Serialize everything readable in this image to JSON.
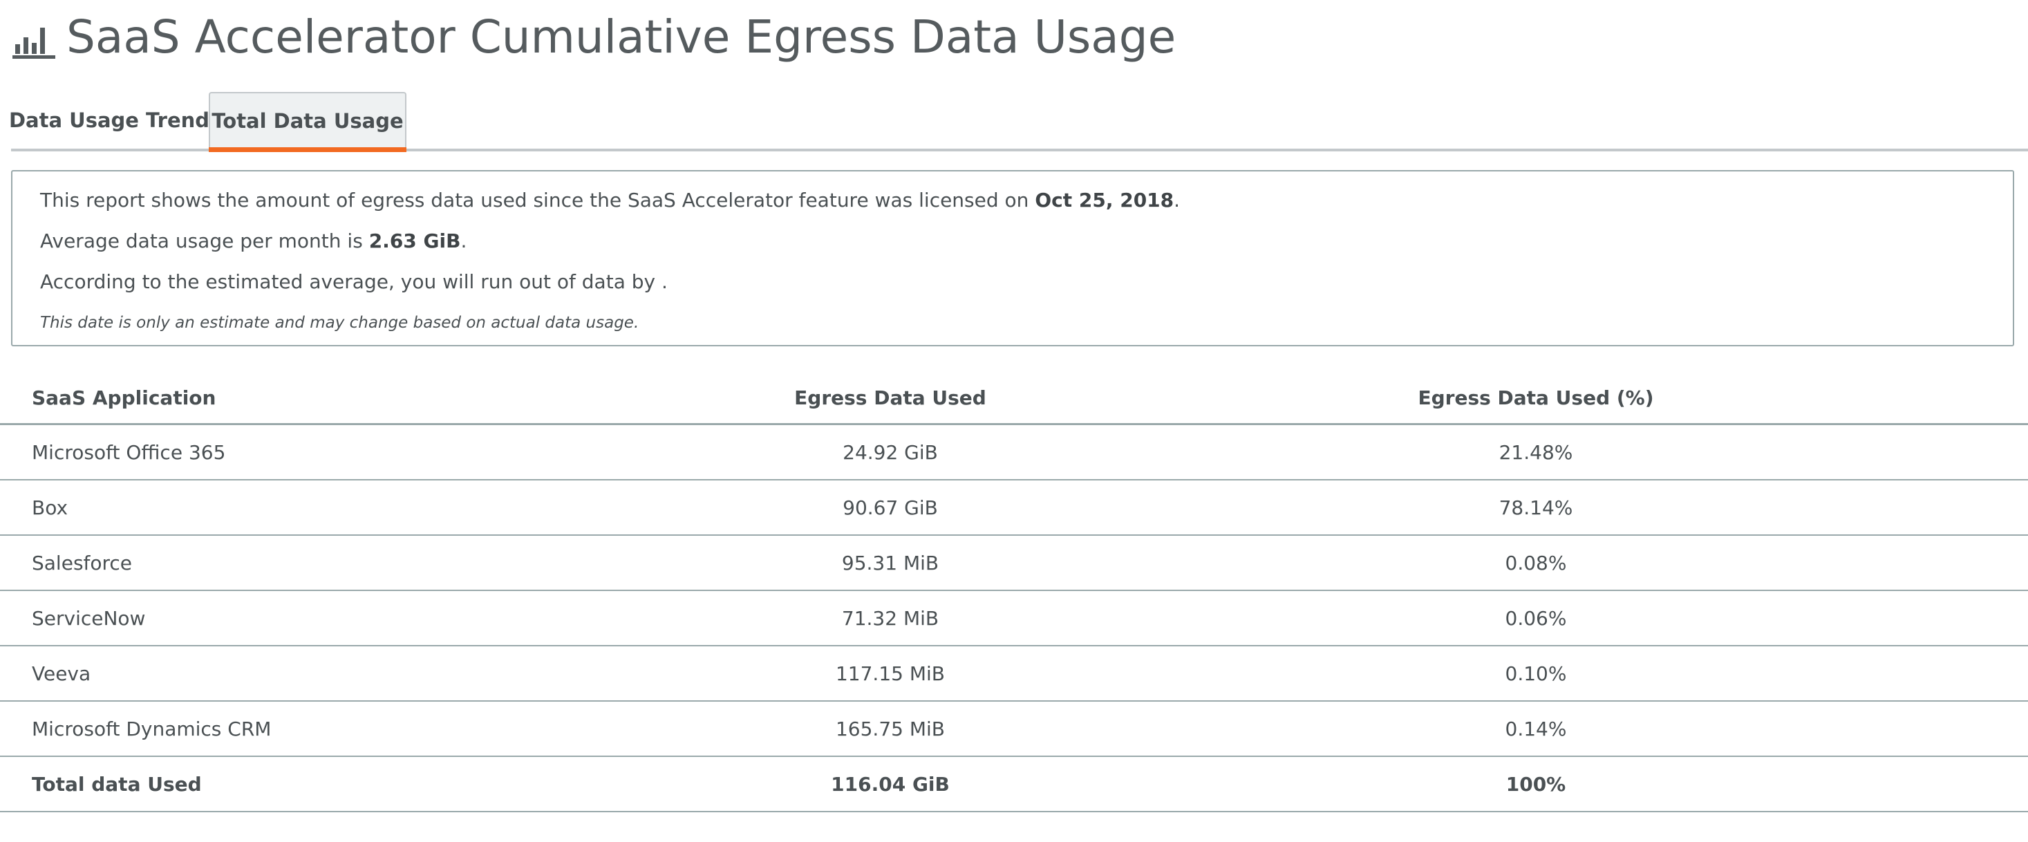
{
  "header": {
    "title": "SaaS Accelerator Cumulative Egress Data Usage",
    "icon": "bar-chart-icon"
  },
  "tabs": [
    {
      "label": "Data Usage Trend",
      "active": false
    },
    {
      "label": "Total Data Usage",
      "active": true
    }
  ],
  "info": {
    "line1_prefix": "This report shows the amount of egress data used since the SaaS Accelerator feature was licensed on ",
    "license_date": "Oct 25, 2018",
    "line1_suffix": ".",
    "line2_prefix": "Average data usage per month is ",
    "avg_usage": "2.63 GiB",
    "line2_suffix": ".",
    "line3": "According to the estimated average, you will run out of data by .",
    "note": "This date is only an estimate and may change based on actual data usage."
  },
  "table": {
    "columns": [
      "SaaS Application",
      "Egress Data Used",
      "Egress Data Used (%)"
    ],
    "rows": [
      {
        "app": "Microsoft Office 365",
        "used": "24.92 GiB",
        "pct": "21.48%"
      },
      {
        "app": "Box",
        "used": "90.67 GiB",
        "pct": "78.14%"
      },
      {
        "app": "Salesforce",
        "used": "95.31 MiB",
        "pct": "0.08%"
      },
      {
        "app": "ServiceNow",
        "used": "71.32 MiB",
        "pct": "0.06%"
      },
      {
        "app": "Veeva",
        "used": "117.15 MiB",
        "pct": "0.10%"
      },
      {
        "app": "Microsoft Dynamics CRM",
        "used": "165.75 MiB",
        "pct": "0.14%"
      }
    ],
    "total": {
      "app": "Total data Used",
      "used": "116.04 GiB",
      "pct": "100%"
    }
  },
  "colors": {
    "text": "#555b5e",
    "accent": "#f26a21",
    "border": "#9aa9ab",
    "tab_active_bg": "#eef1f2"
  }
}
